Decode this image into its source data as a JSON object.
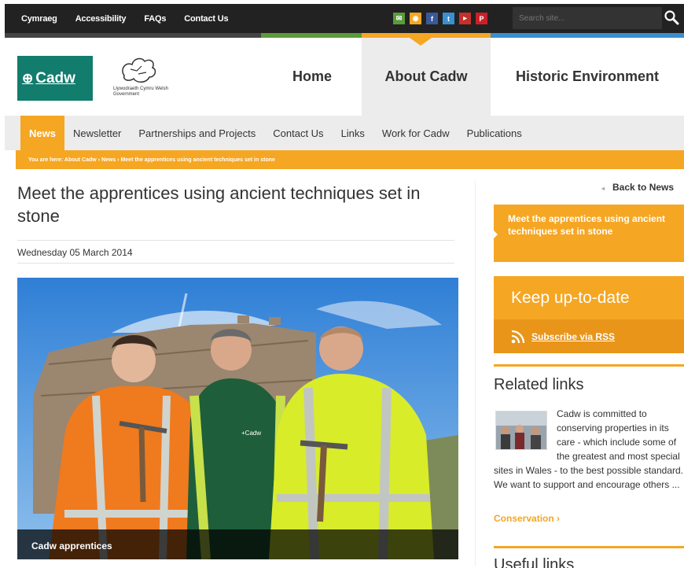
{
  "topbar": {
    "links": [
      "Cymraeg",
      "Accessibility",
      "FAQs",
      "Contact Us"
    ],
    "social_icons": [
      "email-icon",
      "rss-icon",
      "facebook-icon",
      "twitter-icon",
      "youtube-icon",
      "pinterest-icon"
    ],
    "search_placeholder": "Search site..."
  },
  "header": {
    "logo_text": "Cadw",
    "gov_logo_text": "Llywodraeth Cymru Welsh Government",
    "nav": [
      "Home",
      "About Cadw",
      "Historic Environment"
    ],
    "active_nav": "About Cadw"
  },
  "subnav": {
    "items": [
      "News",
      "Newsletter",
      "Partnerships and Projects",
      "Contact Us",
      "Links",
      "Work for Cadw",
      "Publications"
    ],
    "active": "News"
  },
  "breadcrumb": "You are here: About Cadw › News › Meet the apprentices using ancient techniques set in stone",
  "article": {
    "title": "Meet the apprentices using ancient techniques set in stone",
    "date": "Wednesday 05 March 2014",
    "image_caption": "Cadw apprentices"
  },
  "sidebar": {
    "back_link": "Back to News",
    "current_item": "Meet the apprentices using ancient techniques set in stone",
    "keep_up_title": "Keep up-to-date",
    "subscribe_label": "Subscribe via RSS",
    "related_title": "Related links",
    "related_text": "Cadw is committed to conserving properties in its care - which include some of the greatest and most special sites in Wales - to the best possible standard. We want to support and encourage others ...",
    "related_link": "Conservation ›",
    "useful_title": "Useful links"
  },
  "colors": {
    "accent": "#f5a623",
    "brand": "#127c6d",
    "topbar": "#222222",
    "strip": [
      "#444444",
      "#5a9b3a",
      "#f5a623",
      "#3a8fd0"
    ]
  }
}
